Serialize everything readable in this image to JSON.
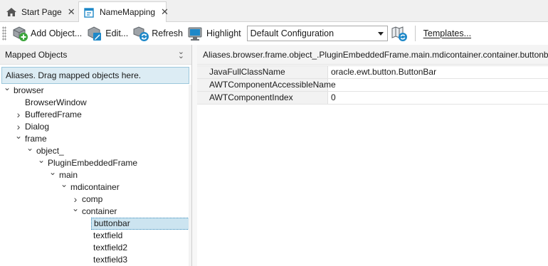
{
  "tabs": [
    {
      "label": "Start Page",
      "icon": "home-icon",
      "active": false
    },
    {
      "label": "NameMapping",
      "icon": "name-mapping-icon",
      "active": true
    }
  ],
  "toolbar": {
    "add_object_label": "Add Object...",
    "edit_label": "Edit...",
    "refresh_label": "Refresh",
    "highlight_label": "Highlight",
    "configuration_value": "Default Configuration",
    "templates_label": "Templates..."
  },
  "mapped_objects": {
    "title": "Mapped Objects",
    "hint": "Aliases. Drag mapped objects here.",
    "tree": [
      {
        "label": "browser",
        "depth": 0,
        "expander": "expanded"
      },
      {
        "label": "BrowserWindow",
        "depth": 1,
        "expander": "none"
      },
      {
        "label": "BufferedFrame",
        "depth": 1,
        "expander": "collapsed"
      },
      {
        "label": "Dialog",
        "depth": 1,
        "expander": "collapsed"
      },
      {
        "label": "frame",
        "depth": 1,
        "expander": "expanded"
      },
      {
        "label": "object_",
        "depth": 2,
        "expander": "expanded"
      },
      {
        "label": "PluginEmbeddedFrame",
        "depth": 3,
        "expander": "expanded"
      },
      {
        "label": "main",
        "depth": 4,
        "expander": "expanded"
      },
      {
        "label": "mdicontainer",
        "depth": 5,
        "expander": "expanded"
      },
      {
        "label": "comp",
        "depth": 6,
        "expander": "collapsed"
      },
      {
        "label": "container",
        "depth": 6,
        "expander": "expanded"
      },
      {
        "label": "buttonbar",
        "depth": 7,
        "expander": "none",
        "selected": true
      },
      {
        "label": "textfield",
        "depth": 7,
        "expander": "none"
      },
      {
        "label": "textfield2",
        "depth": 7,
        "expander": "none"
      },
      {
        "label": "textfield3",
        "depth": 7,
        "expander": "none"
      }
    ]
  },
  "details": {
    "path": "Aliases.browser.frame.object_.PluginEmbeddedFrame.main.mdicontainer.container.buttonbar",
    "properties": [
      {
        "name": "JavaFullClassName",
        "value": "oracle.ewt.button.ButtonBar"
      },
      {
        "name": "AWTComponentAccessibleName",
        "value": ""
      },
      {
        "name": "AWTComponentIndex",
        "value": "0"
      }
    ]
  },
  "colors": {
    "selection_bg": "#cce4f0",
    "hint_bg": "#dcecf4",
    "accent_blue": "#1e88c8",
    "accent_green": "#3aa53a"
  }
}
